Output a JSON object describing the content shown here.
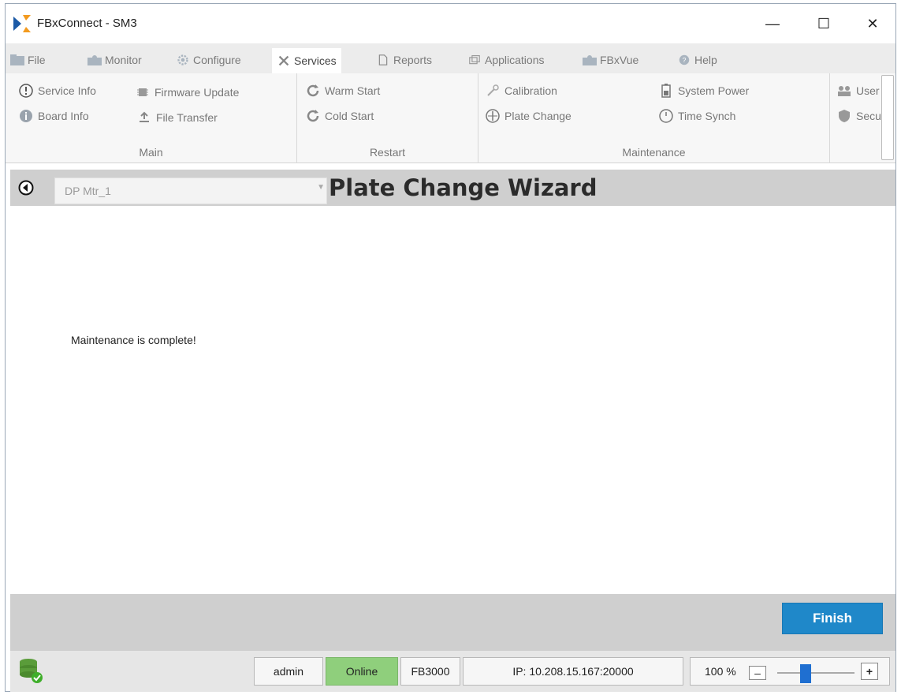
{
  "window": {
    "title": "FBxConnect - SM3",
    "controls": {
      "minimize": "—",
      "maximize": "☐",
      "close": "✕"
    }
  },
  "menu": {
    "items": [
      {
        "label": "File",
        "icon": "folder-icon"
      },
      {
        "label": "Monitor",
        "icon": "monitor-icon"
      },
      {
        "label": "Configure",
        "icon": "gear-icon"
      },
      {
        "label": "Services",
        "icon": "tools-icon",
        "active": true
      },
      {
        "label": "Reports",
        "icon": "document-icon"
      },
      {
        "label": "Applications",
        "icon": "windows-icon"
      },
      {
        "label": "FBxVue",
        "icon": "monitor-icon"
      },
      {
        "label": "Help",
        "icon": "help-icon"
      }
    ]
  },
  "ribbon": {
    "main": {
      "label": "Main",
      "items": [
        "Service Info",
        "Firmware Update",
        "Board Info",
        "File Transfer"
      ]
    },
    "restart": {
      "label": "Restart",
      "items": [
        "Warm Start",
        "Cold Start"
      ]
    },
    "maintenance": {
      "label": "Maintenance",
      "items": [
        "Calibration",
        "System Power",
        "Plate Change",
        "Time Synch"
      ]
    },
    "extra": {
      "items": [
        "User",
        "Secu"
      ]
    }
  },
  "header": {
    "device": "DP Mtr_1",
    "title": "Plate Change Wizard"
  },
  "content": {
    "message": "Maintenance is complete!"
  },
  "footer": {
    "finish_label": "Finish"
  },
  "status": {
    "user": "admin",
    "connection": "Online",
    "model": "FB3000",
    "ip": "IP: 10.208.15.167:20000",
    "zoom": "100 %",
    "zoom_minus": "–",
    "zoom_plus": "+",
    "zoom_level_fraction": 0.35
  },
  "colors": {
    "accent": "#1f88c9",
    "online": "#8fcf7c",
    "header_bg": "#cfcfcf"
  }
}
